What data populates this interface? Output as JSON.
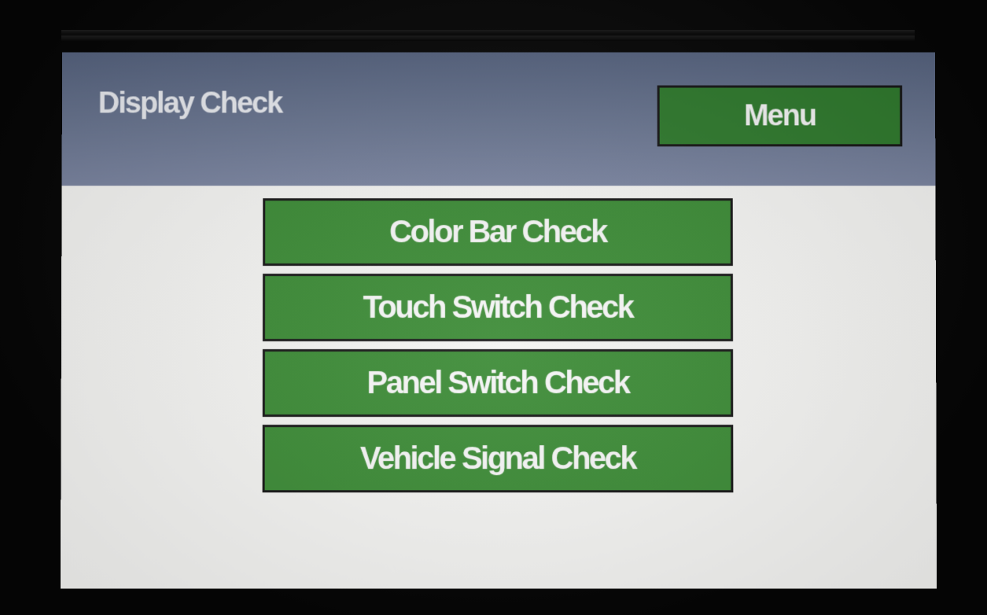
{
  "header": {
    "title": "Display Check",
    "menu_label": "Menu"
  },
  "checks": [
    {
      "label": "Color Bar Check"
    },
    {
      "label": "Touch Switch Check"
    },
    {
      "label": "Panel Switch Check"
    },
    {
      "label": "Vehicle Signal Check"
    }
  ],
  "colors": {
    "header_bg": "#66728d",
    "button_green": "#3a8a34",
    "screen_bg": "#f4f4f2"
  }
}
